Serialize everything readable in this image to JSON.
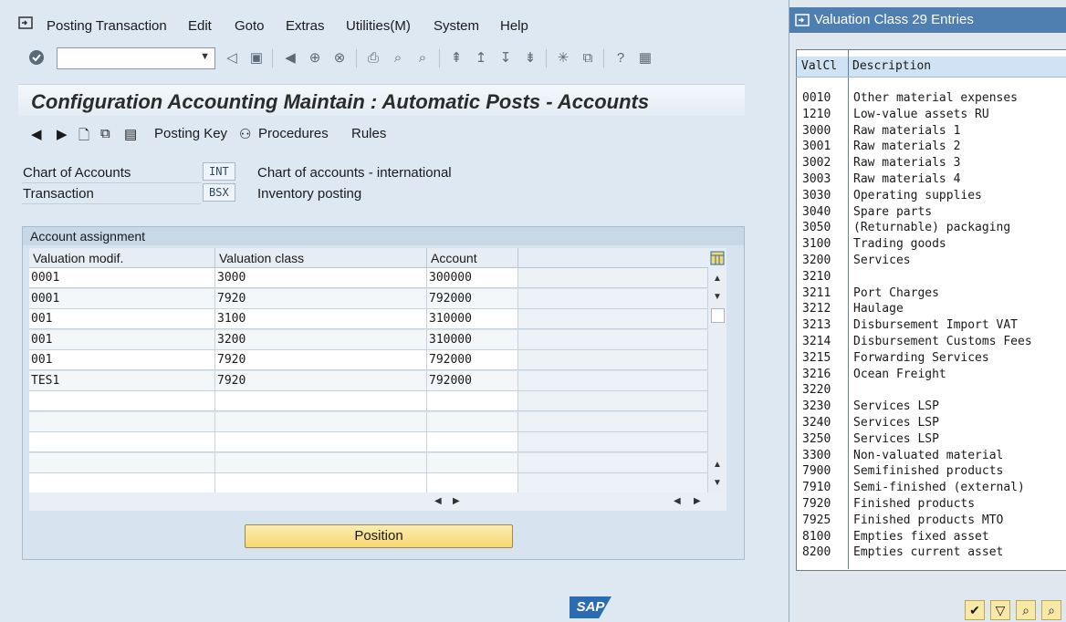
{
  "menu": {
    "items": [
      "Posting Transaction",
      "Edit",
      "Goto",
      "Extras",
      "Utilities(M)",
      "System",
      "Help"
    ]
  },
  "page": {
    "title": "Configuration Accounting Maintain : Automatic Posts - Accounts"
  },
  "app_toolbar": {
    "posting_key": "Posting Key",
    "procedures": "Procedures",
    "rules": "Rules"
  },
  "fields": {
    "chart_label": "Chart of Accounts",
    "chart_value": "INT",
    "chart_desc": "Chart of accounts - international",
    "trans_label": "Transaction",
    "trans_value": "BSX",
    "trans_desc": "Inventory posting"
  },
  "group": {
    "title": "Account assignment"
  },
  "table": {
    "headers": [
      "Valuation modif.",
      "Valuation class",
      "Account"
    ],
    "rows": [
      [
        "0001",
        "3000",
        "300000"
      ],
      [
        "0001",
        "7920",
        "792000"
      ],
      [
        "001",
        "3100",
        "310000"
      ],
      [
        "001",
        "3200",
        "310000"
      ],
      [
        "001",
        "7920",
        "792000"
      ],
      [
        "TES1",
        "7920",
        "792000"
      ]
    ]
  },
  "position_button": "Position",
  "popup": {
    "title": "Valuation Class 29 Entries",
    "headers": [
      "ValCl",
      "Description"
    ],
    "rows": [
      [
        "0010",
        "Other material expenses"
      ],
      [
        "1210",
        "Low-value assets RU"
      ],
      [
        "3000",
        "Raw materials 1"
      ],
      [
        "3001",
        "Raw materials 2"
      ],
      [
        "3002",
        "Raw materials 3"
      ],
      [
        "3003",
        "Raw materials 4"
      ],
      [
        "3030",
        "Operating supplies"
      ],
      [
        "3040",
        "Spare parts"
      ],
      [
        "3050",
        "(Returnable) packaging"
      ],
      [
        "3100",
        "Trading goods"
      ],
      [
        "3200",
        "Services"
      ],
      [
        "3210",
        ""
      ],
      [
        "3211",
        "Port Charges"
      ],
      [
        "3212",
        "Haulage"
      ],
      [
        "3213",
        "Disbursement Import VAT"
      ],
      [
        "3214",
        "Disbursement Customs Fees"
      ],
      [
        "3215",
        "Forwarding Services"
      ],
      [
        "3216",
        "Ocean Freight"
      ],
      [
        "3220",
        ""
      ],
      [
        "3230",
        "Services LSP"
      ],
      [
        "3240",
        "Services LSP"
      ],
      [
        "3250",
        "Services LSP"
      ],
      [
        "3300",
        "Non-valuated material"
      ],
      [
        "7900",
        "Semifinished products"
      ],
      [
        "7910",
        "Semi-finished (external)"
      ],
      [
        "7920",
        "Finished products"
      ],
      [
        "7925",
        "Finished products MTO"
      ],
      [
        "8100",
        "Empties fixed asset"
      ],
      [
        "8200",
        "Empties current asset"
      ]
    ]
  },
  "colors": {
    "popup_title_bg": "#4e7fb0",
    "position_button_bg": "#f6d874",
    "highlight_header": "#cfe3f5"
  }
}
